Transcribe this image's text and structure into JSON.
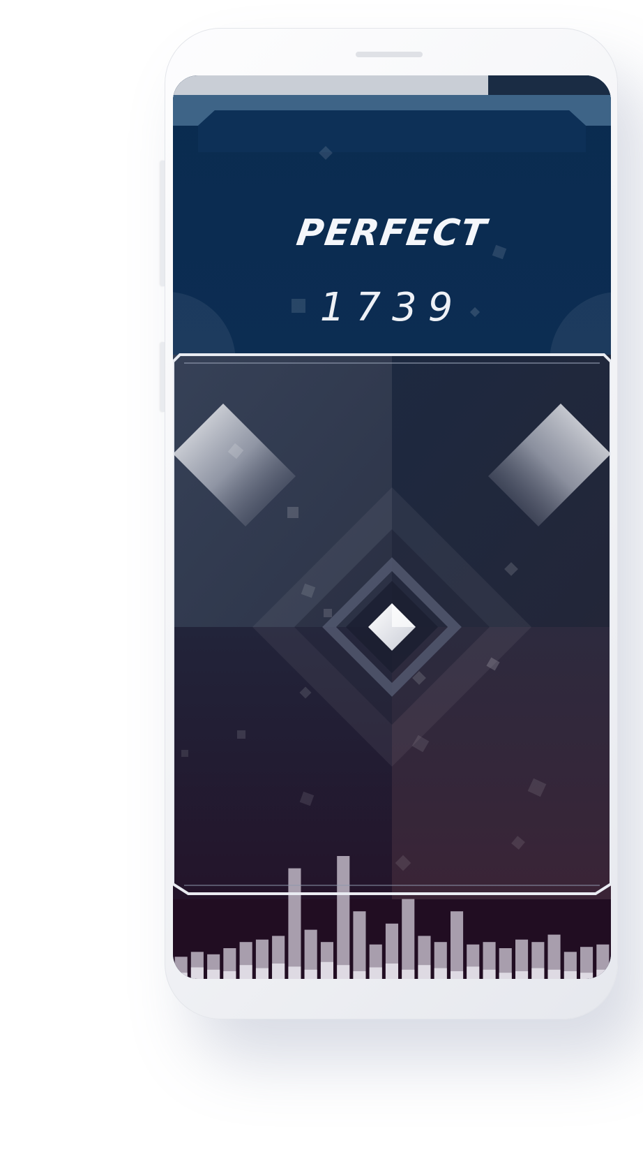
{
  "game": {
    "result_label": "PERFECT",
    "score": "1739",
    "progress_fraction": 0.72
  },
  "colors": {
    "top_panel": "#0b2e52",
    "frame_border": "#e9ecf2",
    "playfield_dark": "#232235",
    "equalizer_bg": "#210d22",
    "bars": "#b7aebd"
  },
  "equalizer": {
    "levels_back": [
      0.18,
      0.22,
      0.2,
      0.25,
      0.3,
      0.32,
      0.35,
      0.9,
      0.4,
      0.3,
      1.0,
      0.55,
      0.28,
      0.45,
      0.65,
      0.35,
      0.3,
      0.55,
      0.28,
      0.3,
      0.25,
      0.32,
      0.3,
      0.36,
      0.22,
      0.26,
      0.28
    ],
    "levels_front": [
      0.08,
      0.15,
      0.12,
      0.1,
      0.18,
      0.14,
      0.2,
      0.16,
      0.12,
      0.22,
      0.18,
      0.1,
      0.15,
      0.2,
      0.12,
      0.18,
      0.14,
      0.1,
      0.16,
      0.12,
      0.08,
      0.1,
      0.14,
      0.12,
      0.1,
      0.08,
      0.12
    ]
  }
}
